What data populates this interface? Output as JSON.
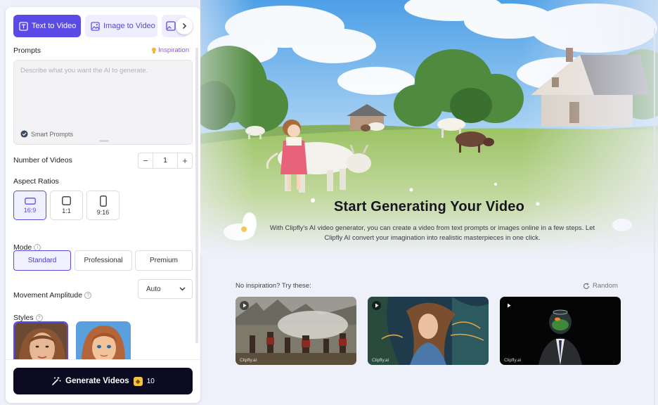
{
  "tabs": {
    "text_to_video": "Text to Video",
    "image_to_video": "Image to Video"
  },
  "prompts": {
    "label": "Prompts",
    "inspiration": "Inspiration",
    "placeholder": "Describe what you want the AI to generate.",
    "smart_prompts": "Smart Prompts"
  },
  "num_videos": {
    "label": "Number of Videos",
    "value": "1",
    "minus": "−",
    "plus": "+"
  },
  "aspect": {
    "label": "Aspect Ratios",
    "options": [
      "16:9",
      "1:1",
      "9:16"
    ],
    "selected": "16:9"
  },
  "mode": {
    "label": "Mode",
    "options": [
      "Standard",
      "Professional",
      "Premium"
    ],
    "selected": "Standard"
  },
  "movement": {
    "label": "Movement Amplitude",
    "value": "Auto"
  },
  "styles": {
    "label": "Styles"
  },
  "generate": {
    "label": "Generate Videos",
    "cost": "10"
  },
  "hero": {
    "title": "Start Generating Your Video",
    "description": "With Clipfly's AI video generator, you can create a video from text prompts or images online in a few steps. Let Clipfly AI convert your imagination into realistic masterpieces in one click."
  },
  "inspiration_section": {
    "prompt": "No inspiration? Try these:",
    "random": "Random",
    "watermark": "Clipfly.ai"
  },
  "colors": {
    "accent": "#5b4be6",
    "button_dark": "#0c0b22",
    "background": "#eef0fa"
  }
}
